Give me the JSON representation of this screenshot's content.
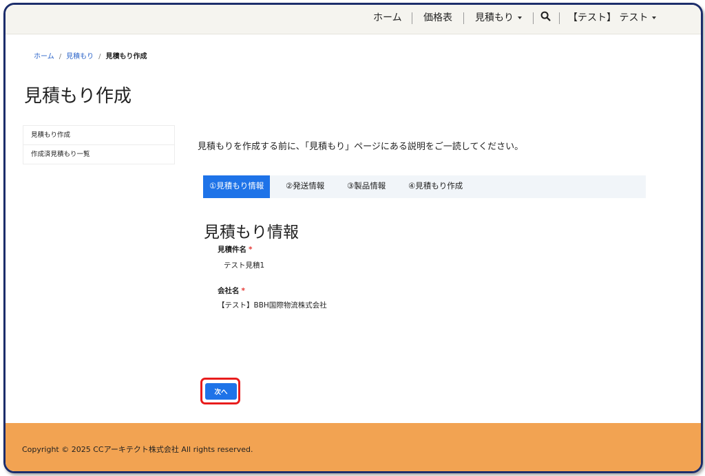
{
  "nav": {
    "home": "ホーム",
    "price_list": "価格表",
    "estimate": "見積もり",
    "user": "【テスト】 テスト"
  },
  "breadcrumb": {
    "home": "ホーム",
    "estimate": "見積もり",
    "current": "見積もり作成"
  },
  "page_title": "見積もり作成",
  "sidemenu": {
    "items": [
      {
        "label": "見積もり作成"
      },
      {
        "label": "作成済見積もり一覧"
      }
    ]
  },
  "intro": "見積もりを作成する前に、「見積もり」ページにある説明をご一読してください。",
  "steps": [
    {
      "label": "①見積もり情報",
      "active": true
    },
    {
      "label": "②発送情報",
      "active": false
    },
    {
      "label": "③製品情報",
      "active": false
    },
    {
      "label": "④見積もり作成",
      "active": false
    }
  ],
  "section_title": "見積もり情報",
  "form": {
    "estimate_name_label": "見積件名",
    "estimate_name_value": "テスト見積1",
    "company_label": "会社名",
    "company_value": "【テスト】BBH国際物流株式会社",
    "required_mark": "*"
  },
  "next_button": "次へ",
  "footer": {
    "copyright": "Copyright © 2025 CCアーキテクト株式会社 All rights reserved."
  },
  "colors": {
    "primary": "#1e73e8",
    "footer": "#f2a352",
    "highlight": "#e81c1c",
    "frame": "#1c2d6b"
  }
}
